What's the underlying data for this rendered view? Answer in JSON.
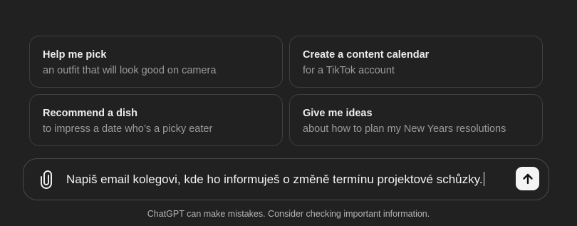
{
  "suggestions": [
    {
      "title": "Help me pick",
      "subtitle": "an outfit that will look good on camera"
    },
    {
      "title": "Create a content calendar",
      "subtitle": "for a TikTok account"
    },
    {
      "title": "Recommend a dish",
      "subtitle": "to impress a date who’s a picky eater"
    },
    {
      "title": "Give me ideas",
      "subtitle": "about how to plan my New Years resolutions"
    }
  ],
  "composer": {
    "value": "Napiš email kolegovi, kde ho informuješ o změně termínu projektové schůzky.",
    "attach_icon": "paperclip-icon",
    "send_icon": "arrow-up-icon"
  },
  "footer": {
    "disclaimer": "ChatGPT can make mistakes. Consider checking important information."
  },
  "colors": {
    "background": "#212121",
    "card_border": "#3f3f3f",
    "title_text": "#ececec",
    "subtitle_text": "#9b9b9b",
    "send_button_bg": "#f4f4f4"
  }
}
